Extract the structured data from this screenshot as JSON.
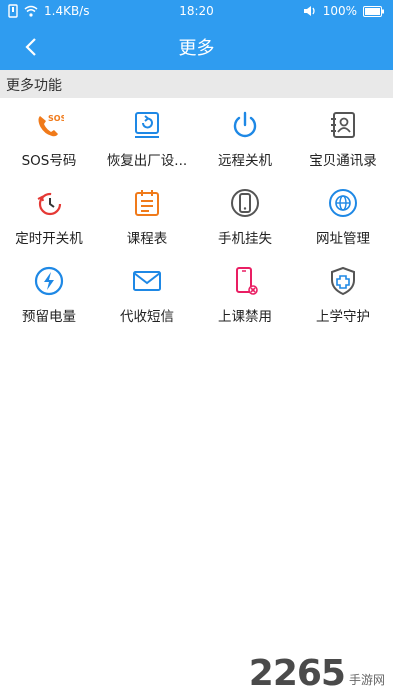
{
  "status_bar": {
    "network_speed": "1.4KB/s",
    "time": "18:20",
    "battery": "100%"
  },
  "header": {
    "title": "更多"
  },
  "section": {
    "title": "更多功能"
  },
  "functions": [
    {
      "label": "SOS号码",
      "icon": "sos-phone-icon",
      "color": "#f07a1a",
      "icon_text": "SOS"
    },
    {
      "label": "恢复出厂设...",
      "icon": "factory-reset-icon",
      "color": "#1e88e5"
    },
    {
      "label": "远程关机",
      "icon": "power-icon",
      "color": "#1e88e5"
    },
    {
      "label": "宝贝通讯录",
      "icon": "contacts-icon",
      "color": "#555555"
    },
    {
      "label": "定时开关机",
      "icon": "timer-power-icon",
      "color": "#e53935"
    },
    {
      "label": "课程表",
      "icon": "schedule-icon",
      "color": "#f07a1a"
    },
    {
      "label": "手机挂失",
      "icon": "phone-lost-icon",
      "color": "#555555"
    },
    {
      "label": "网址管理",
      "icon": "globe-icon",
      "color": "#1e88e5"
    },
    {
      "label": "预留电量",
      "icon": "battery-reserve-icon",
      "color": "#1e88e5"
    },
    {
      "label": "代收短信",
      "icon": "mail-icon",
      "color": "#1e88e5"
    },
    {
      "label": "上课禁用",
      "icon": "class-disable-icon",
      "color": "#e91e63"
    },
    {
      "label": "上学守护",
      "icon": "guard-shield-icon",
      "color": "#555555"
    }
  ],
  "watermark": {
    "number": "2265",
    "site": "手游网"
  }
}
